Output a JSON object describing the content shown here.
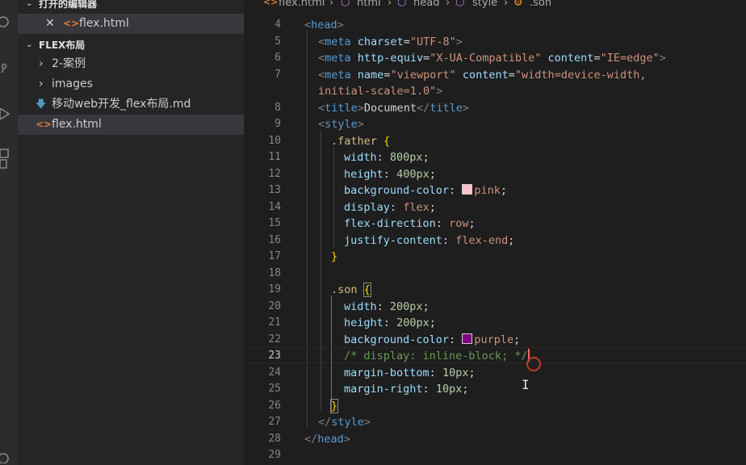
{
  "sidebar": {
    "open_editors_title": "打开的编辑器",
    "open_file": "flex.html",
    "project_title": "FLEX布局",
    "items": [
      {
        "label": "2-案例"
      },
      {
        "label": "images"
      },
      {
        "label": "移动web开发_flex布局.md"
      },
      {
        "label": "flex.html"
      }
    ]
  },
  "breadcrumb": {
    "file": "flex.html",
    "html": "html",
    "head": "head",
    "style": "style",
    "son": ".son"
  },
  "editor": {
    "active_line": 23,
    "lines": [
      {
        "n": "4"
      },
      {
        "n": "5"
      },
      {
        "n": "6"
      },
      {
        "n": "7"
      },
      {
        "n": ""
      },
      {
        "n": "8"
      },
      {
        "n": "9"
      },
      {
        "n": "10"
      },
      {
        "n": "11"
      },
      {
        "n": "12"
      },
      {
        "n": "13"
      },
      {
        "n": "14"
      },
      {
        "n": "15"
      },
      {
        "n": "16"
      },
      {
        "n": "17"
      },
      {
        "n": "18"
      },
      {
        "n": "19"
      },
      {
        "n": "20"
      },
      {
        "n": "21"
      },
      {
        "n": "22"
      },
      {
        "n": "23"
      },
      {
        "n": "24"
      },
      {
        "n": "25"
      },
      {
        "n": "26"
      },
      {
        "n": "27"
      },
      {
        "n": "28"
      },
      {
        "n": "29"
      }
    ],
    "code": {
      "l4": [
        "<",
        "head",
        ">"
      ],
      "l5": [
        "<",
        "meta",
        "charset",
        "=",
        "\"UTF-8\"",
        ">"
      ],
      "l6": [
        "<",
        "meta",
        "http-equiv",
        "=",
        "\"X-UA-Compatible\"",
        "content",
        "=",
        "\"IE=edge\"",
        ">"
      ],
      "l7a": [
        "<",
        "meta",
        "name",
        "=",
        "\"viewport\"",
        "content",
        "=",
        "\"width=device-width,"
      ],
      "l7b": [
        "initial-scale=1.0\"",
        ">"
      ],
      "l8": [
        "<",
        "title",
        ">",
        "Document",
        "</",
        "title",
        ">"
      ],
      "l9": [
        "<",
        "style",
        ">"
      ],
      "l10": [
        ".father",
        "{"
      ],
      "l11": [
        "width",
        ":",
        "800px",
        ";"
      ],
      "l12": [
        "height",
        ":",
        "400px",
        ";"
      ],
      "l13": [
        "background-color",
        ":",
        "pink",
        ";"
      ],
      "l14": [
        "display",
        ":",
        "flex",
        ";"
      ],
      "l15": [
        "flex-direction",
        ":",
        "row",
        ";"
      ],
      "l16": [
        "justify-content",
        ":",
        "flex-end",
        ";"
      ],
      "l17": [
        "}"
      ],
      "l19": [
        ".son",
        "{"
      ],
      "l20": [
        "width",
        ":",
        "200px",
        ";"
      ],
      "l21": [
        "height",
        ":",
        "200px",
        ";"
      ],
      "l22": [
        "background-color",
        ":",
        "purple",
        ";"
      ],
      "l23": [
        "/* display: inline-block; */"
      ],
      "l24": [
        "margin-bottom",
        ":",
        "10px",
        ";"
      ],
      "l25": [
        "margin-right",
        ":",
        "10px",
        ";"
      ],
      "l26": [
        "}"
      ],
      "l27": [
        "</",
        "style",
        ">"
      ],
      "l28": [
        "</",
        "head",
        ">"
      ]
    },
    "swatch_colors": {
      "pink": "#ffc0cb",
      "purple": "#800080"
    }
  }
}
